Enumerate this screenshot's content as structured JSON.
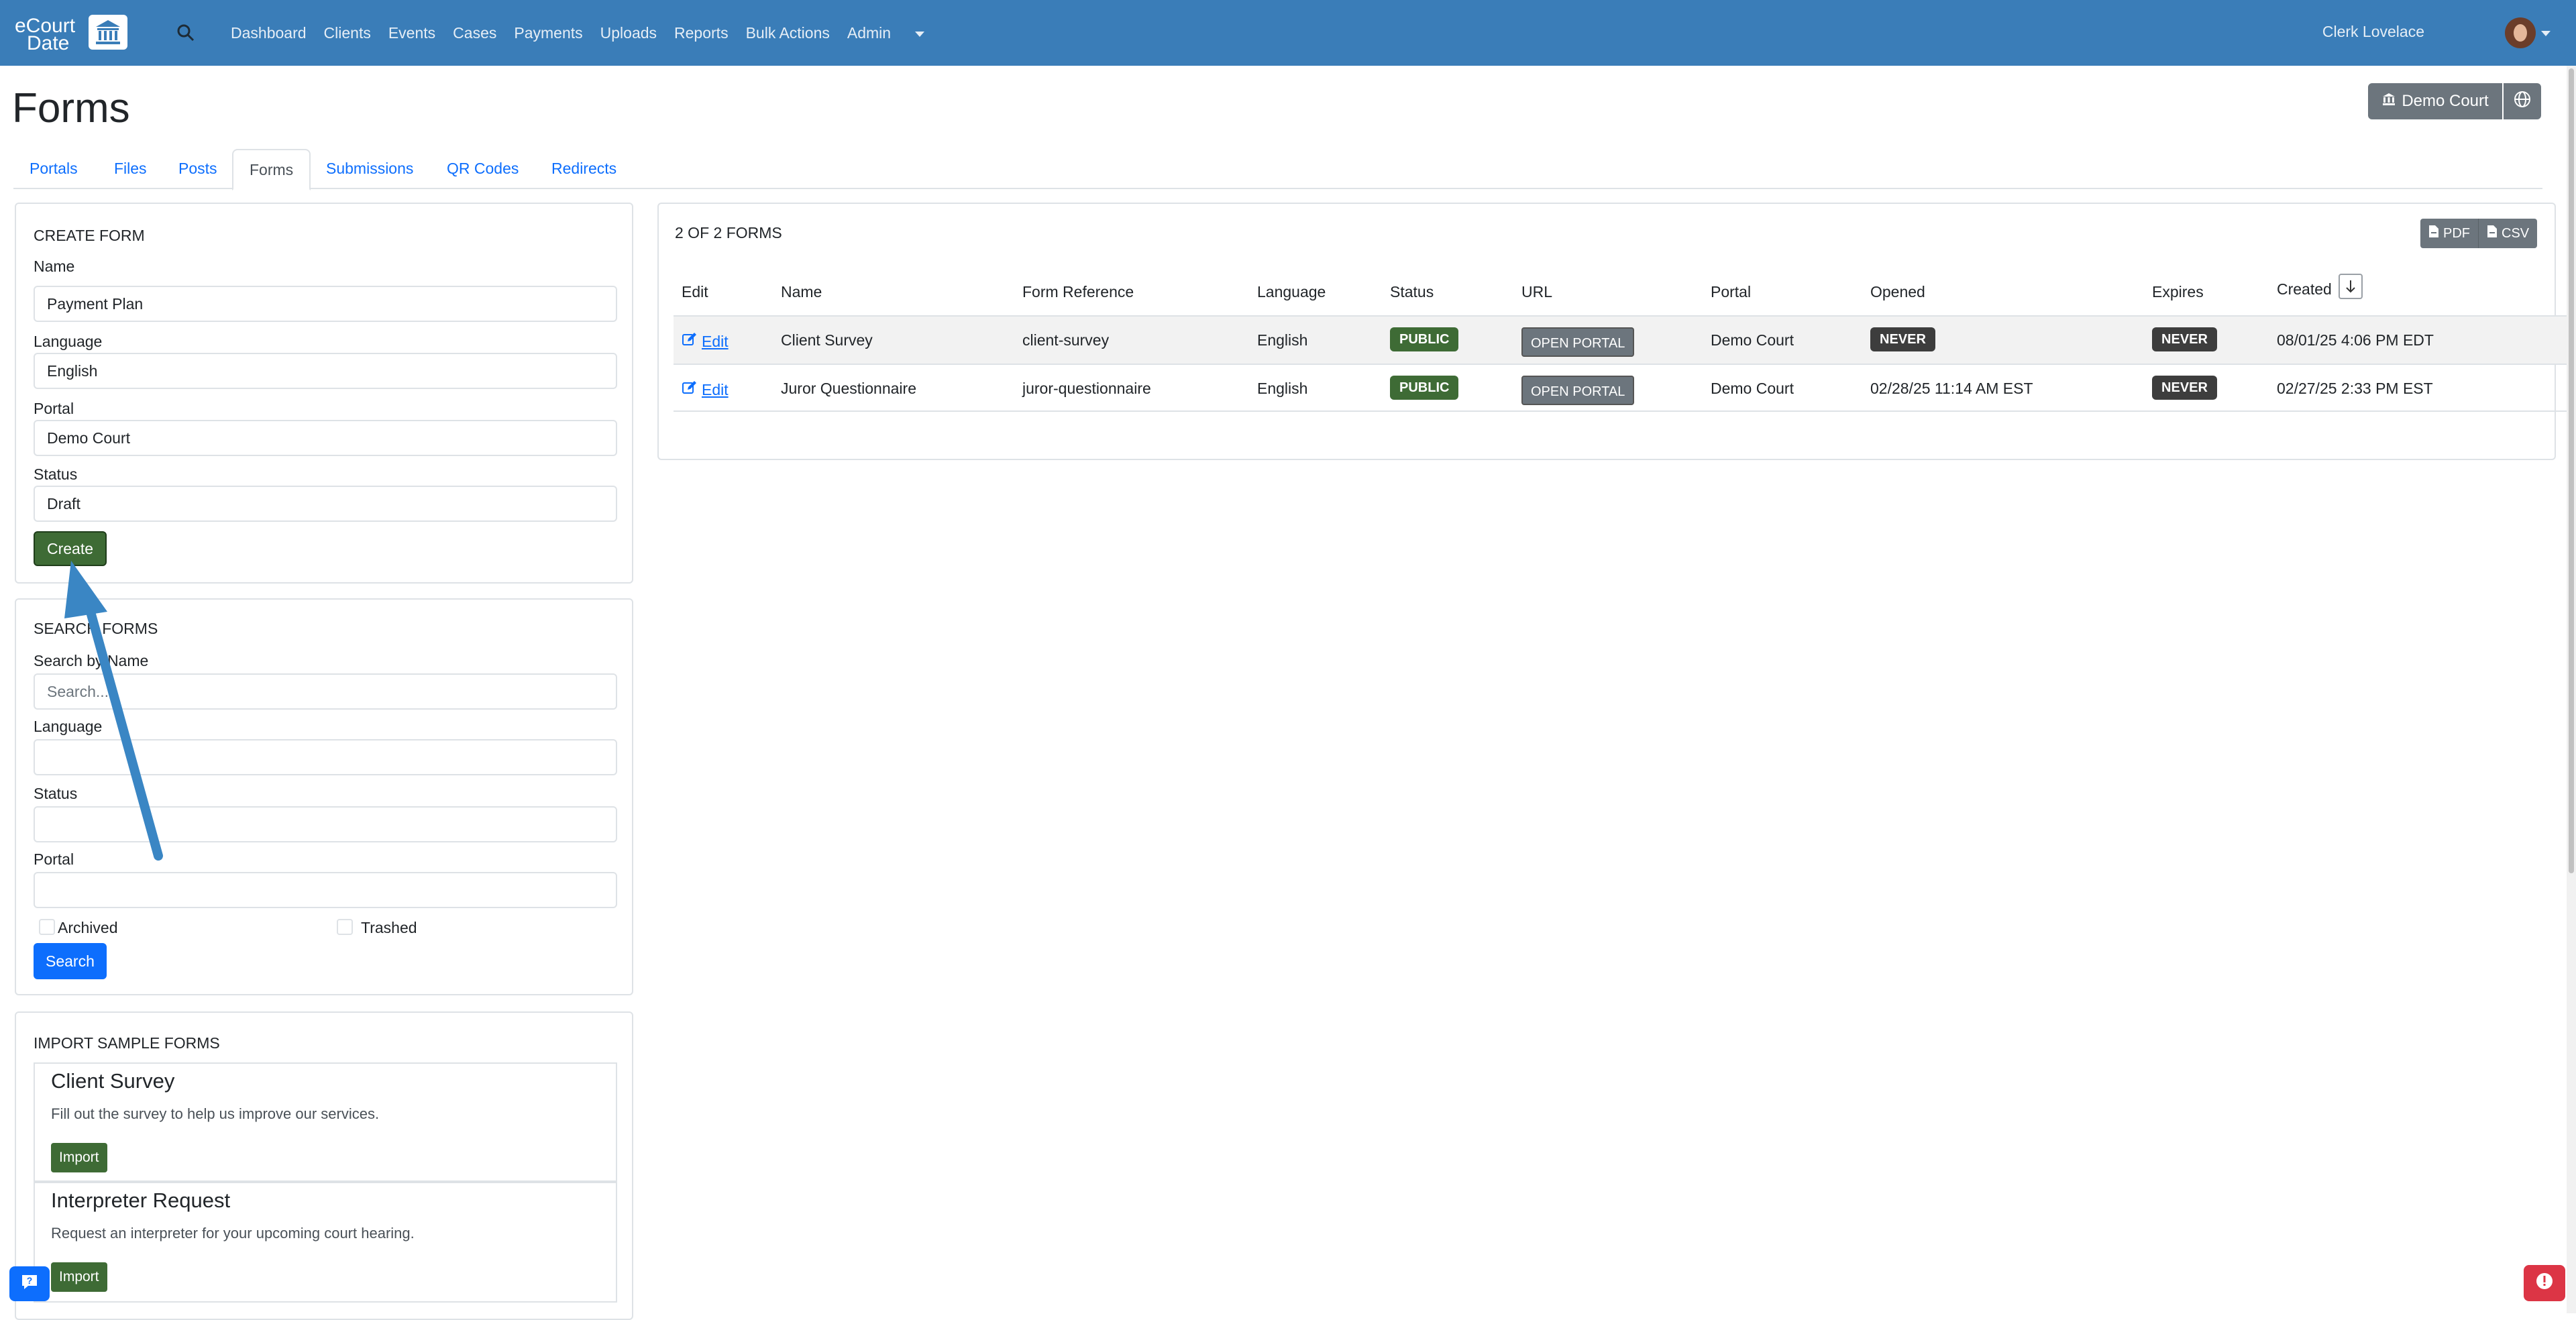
{
  "navbar": {
    "logo_line1": "eCourt",
    "logo_line2": "Date",
    "links": [
      "Dashboard",
      "Clients",
      "Events",
      "Cases",
      "Payments",
      "Uploads",
      "Reports",
      "Bulk Actions",
      "Admin"
    ],
    "user_name": "Clerk Lovelace"
  },
  "page": {
    "title": "Forms",
    "court_button": "Demo Court"
  },
  "tabs": [
    "Portals",
    "Files",
    "Posts",
    "Forms",
    "Submissions",
    "QR Codes",
    "Redirects"
  ],
  "active_tab": "Forms",
  "create_form": {
    "title": "CREATE FORM",
    "name_label": "Name",
    "name_value": "Payment Plan",
    "language_label": "Language",
    "language_value": "English",
    "portal_label": "Portal",
    "portal_value": "Demo Court",
    "status_label": "Status",
    "status_value": "Draft",
    "create_button": "Create"
  },
  "search_forms": {
    "title": "SEARCH FORMS",
    "name_label": "Search by Name",
    "name_placeholder": "Search...",
    "language_label": "Language",
    "status_label": "Status",
    "portal_label": "Portal",
    "archived_label": "Archived",
    "trashed_label": "Trashed",
    "search_button": "Search"
  },
  "import_samples": {
    "title": "IMPORT SAMPLE FORMS",
    "items": [
      {
        "title": "Client Survey",
        "description": "Fill out the survey to help us improve our services.",
        "button": "Import"
      },
      {
        "title": "Interpreter Request",
        "description": "Request an interpreter for your upcoming court hearing.",
        "button": "Import"
      }
    ]
  },
  "forms_table": {
    "count_text": "2 OF 2 FORMS",
    "export_pdf": "PDF",
    "export_csv": "CSV",
    "columns": [
      "Edit",
      "Name",
      "Form Reference",
      "Language",
      "Status",
      "URL",
      "Portal",
      "Opened",
      "Expires",
      "Created"
    ],
    "rows": [
      {
        "edit": "Edit",
        "name": "Client Survey",
        "reference": "client-survey",
        "language": "English",
        "status": "PUBLIC",
        "url": "OPEN PORTAL",
        "portal": "Demo Court",
        "opened": "NEVER",
        "expires": "NEVER",
        "created": "08/01/25 4:06 PM EDT"
      },
      {
        "edit": "Edit",
        "name": "Juror Questionnaire",
        "reference": "juror-questionnaire",
        "language": "English",
        "status": "PUBLIC",
        "url": "OPEN PORTAL",
        "portal": "Demo Court",
        "opened": "02/28/25 11:14 AM EST",
        "expires": "NEVER",
        "created": "02/27/25 2:33 PM EST"
      }
    ]
  },
  "colors": {
    "navbar": "#3a7db8",
    "success": "#3e6b35",
    "primary": "#0d6efd",
    "secondary": "#6c757d",
    "danger": "#dc3545",
    "annotation_arrow": "#3a86c4"
  },
  "icons": [
    "search-icon",
    "bank-icon",
    "globe-icon",
    "pdf-file-icon",
    "csv-file-icon",
    "sort-down-icon",
    "edit-icon",
    "help-icon",
    "alert-icon"
  ]
}
